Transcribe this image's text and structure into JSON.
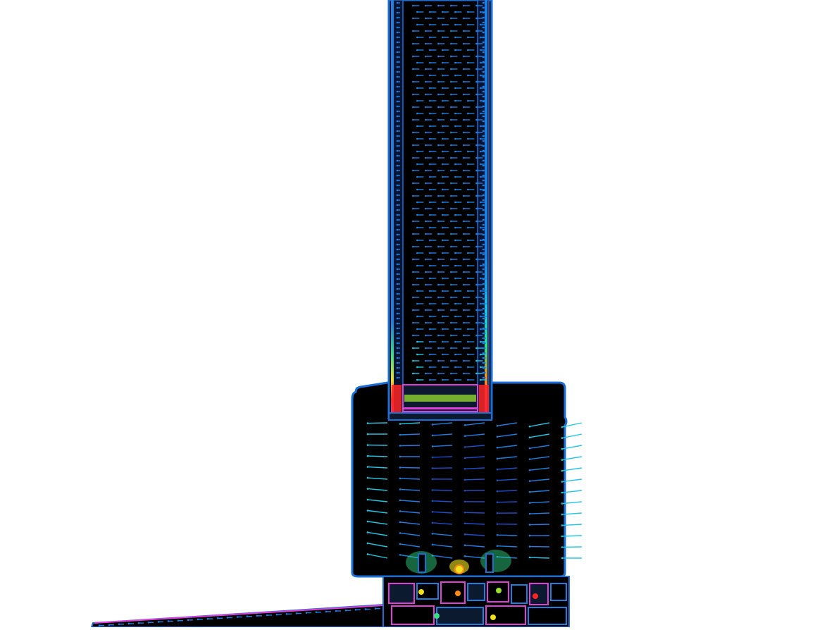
{
  "figure": {
    "kind": "heat-flux vector field over window frame cross-section",
    "visible_text": []
  },
  "colors": {
    "background": "#ffffff",
    "solid_fill": "#000000",
    "outline": "#1a6fd8",
    "flux_scale": [
      "#1d4fc8",
      "#1f7fe0",
      "#22c6e6",
      "#33e08a",
      "#9be030",
      "#f2e21d",
      "#ff8a1c",
      "#ff2424",
      "#e040d8"
    ]
  },
  "regions": [
    {
      "name": "glazing-unit",
      "dominant_color": "#1f7fe0"
    },
    {
      "name": "spacer-edge",
      "dominant_color": "#ff2424"
    },
    {
      "name": "sash-frame",
      "dominant_color": "#22c6e6"
    },
    {
      "name": "frame-profile",
      "dominant_color": "#e040d8"
    },
    {
      "name": "sill",
      "dominant_color": "#1f7fe0"
    }
  ]
}
